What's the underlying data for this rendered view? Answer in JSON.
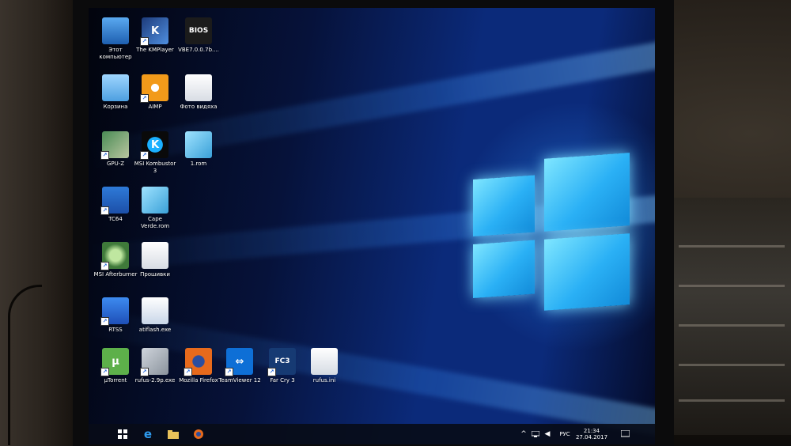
{
  "desktop": {
    "icons": [
      {
        "label": "Этот компьютер",
        "icon": "computer-icon",
        "col": 0,
        "row": 0
      },
      {
        "label": "The KMPlayer",
        "icon": "kmplayer-icon",
        "col": 1,
        "row": 0
      },
      {
        "label": "VBE7.0.0.7b....",
        "icon": "bios-icon",
        "col": 2,
        "row": 0
      },
      {
        "label": "Корзина",
        "icon": "recycle-bin-icon",
        "col": 0,
        "row": 1
      },
      {
        "label": "AIMP",
        "icon": "aimp-icon",
        "col": 1,
        "row": 1
      },
      {
        "label": "Фото видяха",
        "icon": "folder-icon",
        "col": 2,
        "row": 1
      },
      {
        "label": "GPU-Z",
        "icon": "gpuz-icon",
        "col": 0,
        "row": 2
      },
      {
        "label": "MSI Kombustor 3",
        "icon": "kombustor-icon",
        "col": 1,
        "row": 2
      },
      {
        "label": "1.rom",
        "icon": "rom-file-icon",
        "col": 2,
        "row": 2
      },
      {
        "label": "TC64",
        "icon": "tc64-icon",
        "col": 0,
        "row": 3
      },
      {
        "label": "Cape Verde.rom",
        "icon": "rom-file-icon",
        "col": 1,
        "row": 3
      },
      {
        "label": "MSI Afterburner",
        "icon": "afterburner-icon",
        "col": 0,
        "row": 4
      },
      {
        "label": "Прошивки",
        "icon": "folder-icon",
        "col": 1,
        "row": 4
      },
      {
        "label": "RTSS",
        "icon": "rtss-icon",
        "col": 0,
        "row": 5
      },
      {
        "label": "atiflash.exe",
        "icon": "exe-icon",
        "col": 1,
        "row": 5
      },
      {
        "label": "µTorrent",
        "icon": "utorrent-icon",
        "col": 0,
        "row": 6
      },
      {
        "label": "rufus-2.9p.exe",
        "icon": "rufus-icon",
        "col": 1,
        "row": 6
      },
      {
        "label": "Mozilla Firefox",
        "icon": "firefox-icon",
        "col": 2,
        "row": 6
      },
      {
        "label": "TeamViewer 12",
        "icon": "teamviewer-icon",
        "col": 3,
        "row": 6
      },
      {
        "label": "Far Cry 3",
        "icon": "farcry3-icon",
        "col": 4,
        "row": 6
      },
      {
        "label": "rufus.ini",
        "icon": "ini-file-icon",
        "col": 5,
        "row": 6
      }
    ],
    "colors": {
      "wallpaper_glow": "#2ab0f5",
      "wallpaper_dark": "#06123a"
    }
  },
  "taskbar": {
    "apps": [
      {
        "name": "start",
        "icon": "windows-start-icon"
      },
      {
        "name": "edge",
        "icon": "edge-icon"
      },
      {
        "name": "explorer",
        "icon": "file-explorer-icon"
      },
      {
        "name": "firefox",
        "icon": "firefox-icon"
      }
    ],
    "tray": {
      "language": "РУС",
      "time": "21:34",
      "date": "27.04.2017"
    }
  }
}
